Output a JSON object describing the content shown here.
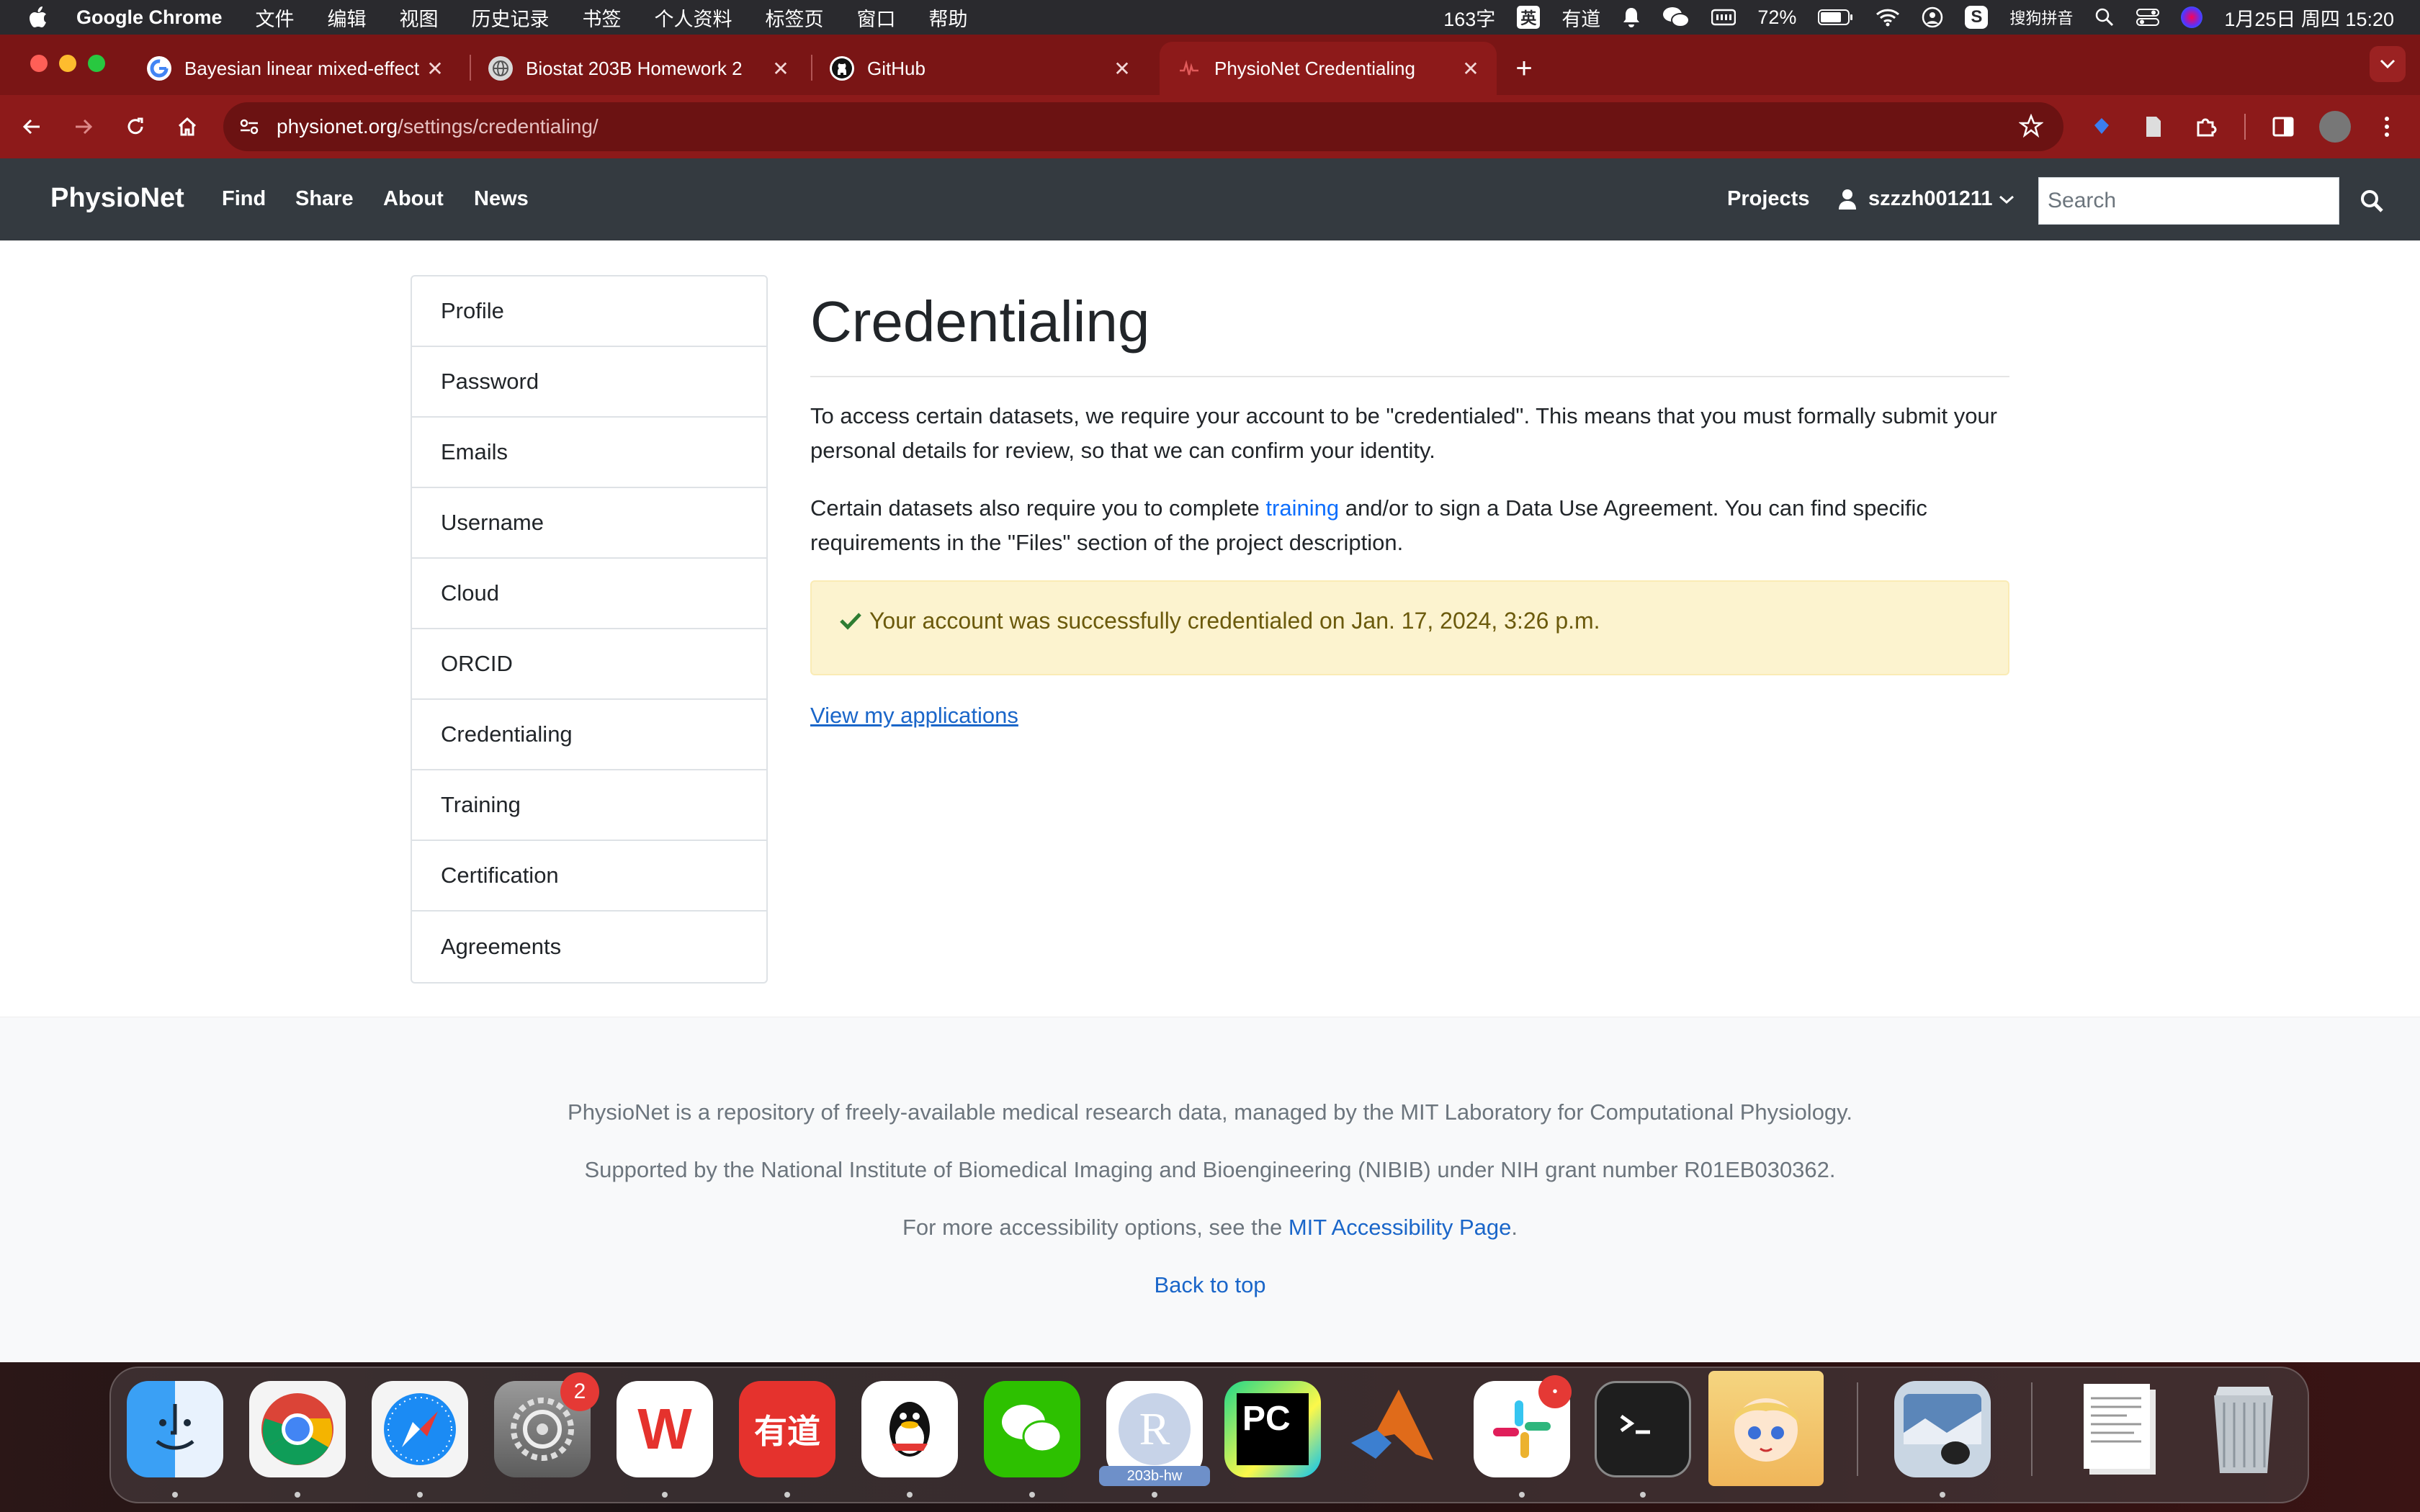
{
  "menubar": {
    "app_name": "Google Chrome",
    "items": [
      "文件",
      "编辑",
      "视图",
      "历史记录",
      "书签",
      "个人资料",
      "标签页",
      "窗口",
      "帮助"
    ],
    "status": {
      "word_count": "163字",
      "ime_badge": "英",
      "youdao": "有道",
      "battery": "72%",
      "ime_name": "搜狗拼音",
      "datetime": "1月25日 周四  15:20"
    }
  },
  "tabs": [
    {
      "title": "Bayesian linear mixed-effect m",
      "favicon": "google-icon",
      "active": false
    },
    {
      "title": "Biostat 203B Homework 2",
      "favicon": "globe-icon",
      "active": false
    },
    {
      "title": "GitHub",
      "favicon": "github-icon",
      "active": false
    },
    {
      "title": "PhysioNet Credentialing",
      "favicon": "physionet-icon",
      "active": true
    }
  ],
  "address_bar": {
    "domain": "physionet.org",
    "path": "/settings/credentialing/"
  },
  "navbar": {
    "brand": "PhysioNet",
    "links": [
      "Find",
      "Share",
      "About",
      "News"
    ],
    "projects": "Projects",
    "username": "szzzh001211",
    "search_placeholder": "Search"
  },
  "sidenav": [
    "Profile",
    "Password",
    "Emails",
    "Username",
    "Cloud",
    "ORCID",
    "Credentialing",
    "Training",
    "Certification",
    "Agreements"
  ],
  "main": {
    "title": "Credentialing",
    "para1": "To access certain datasets, we require your account to be \"credentialed\". This means that you must formally submit your personal details for review, so that we can confirm your identity.",
    "para2_before": "Certain datasets also require you to complete ",
    "para2_link": "training",
    "para2_after": " and/or to sign a Data Use Agreement. You can find specific requirements in the \"Files\" section of the project description.",
    "alert": "Your account was successfully credentialed on Jan. 17, 2024, 3:26 p.m.",
    "view_link": "View my applications"
  },
  "footer": {
    "line1": "PhysioNet is a repository of freely-available medical research data, managed by the MIT Laboratory for Computational Physiology.",
    "line2": "Supported by the National Institute of Biomedical Imaging and Bioengineering (NIBIB) under NIH grant number R01EB030362.",
    "line3_before": "For more accessibility options, see the ",
    "line3_link": "MIT Accessibility Page",
    "line3_after": ".",
    "back_to_top": "Back to top"
  },
  "dock": {
    "apps": [
      "Finder",
      "Google Chrome",
      "Safari",
      "System Settings",
      "WPS Office",
      "Youdao Dictionary",
      "QQ",
      "WeChat",
      "R",
      "PyCharm",
      "MATLAB",
      "Slack",
      "Terminal",
      "Anime Avatar",
      "Preview",
      "Documents",
      "Trash"
    ],
    "settings_badge": "2",
    "r_label": "203b-hw",
    "r_letter": "R",
    "pycharm_letters": "PC",
    "wps_letter": "W",
    "youdao_text": "有道"
  },
  "colors": {
    "accent_link": "#1a66c9",
    "tabbar": "#7a1515",
    "navbar": "#343a40",
    "alert_bg": "#fcf3cf",
    "success": "#2e7d32"
  }
}
